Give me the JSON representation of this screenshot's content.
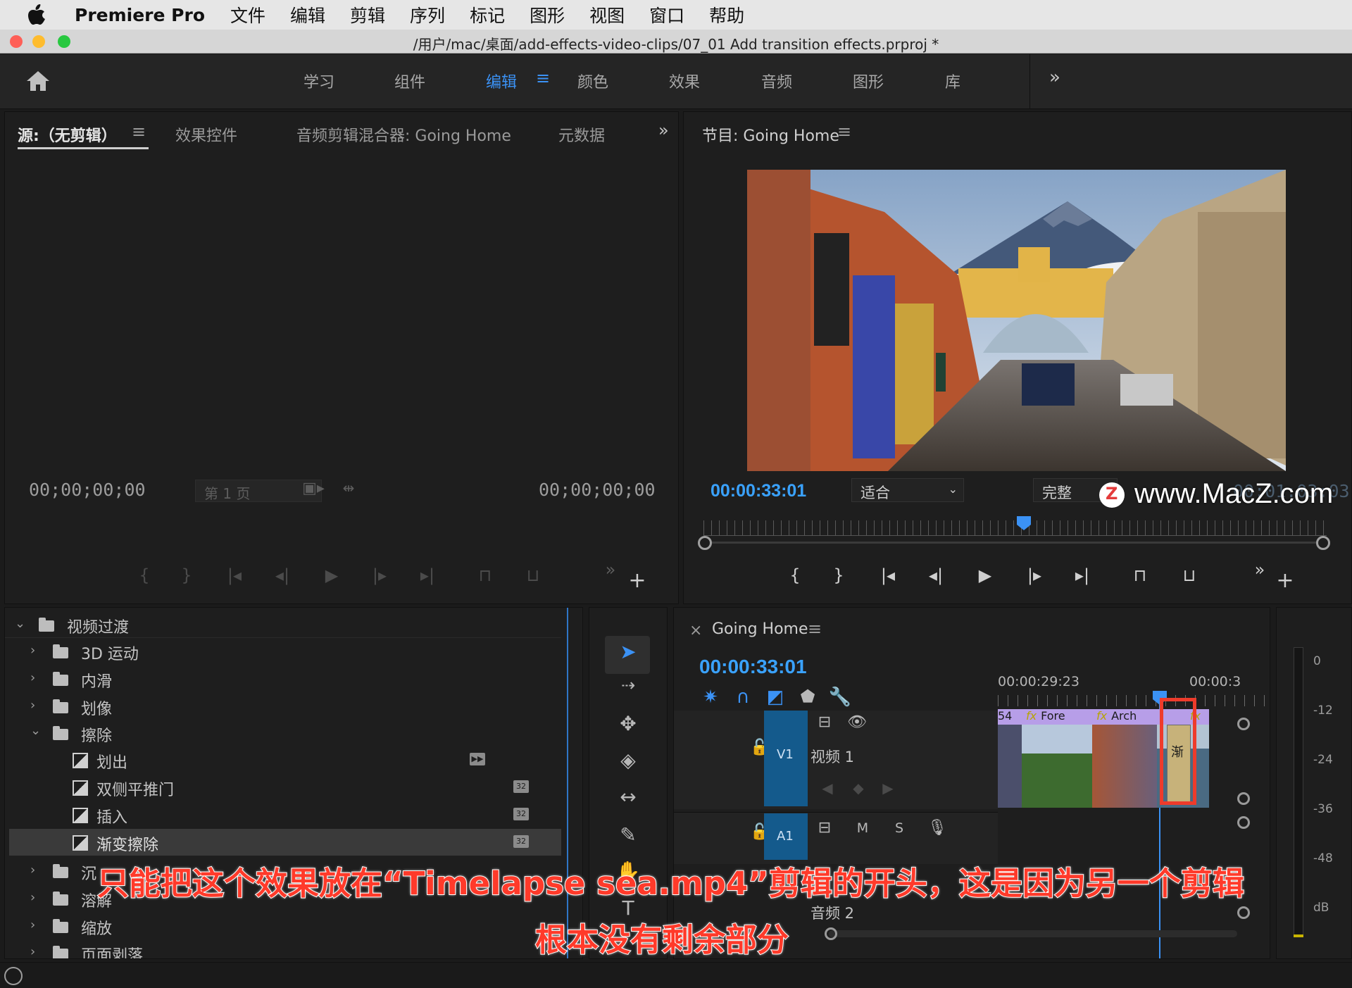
{
  "menubar": {
    "app_name": "Premiere Pro",
    "items": [
      "文件",
      "编辑",
      "剪辑",
      "序列",
      "标记",
      "图形",
      "视图",
      "窗口",
      "帮助"
    ]
  },
  "titlebar": {
    "path": "/用户/mac/桌面/add-effects-video-clips/07_01 Add transition effects.prproj *"
  },
  "workspaces": {
    "tabs": [
      "学习",
      "组件",
      "编辑",
      "颜色",
      "效果",
      "音频",
      "图形",
      "库"
    ],
    "active": "编辑"
  },
  "source_panel": {
    "tabs": [
      "源:（无剪辑）",
      "效果控件",
      "音频剪辑混合器: Going Home",
      "元数据"
    ],
    "timecode_left": "00;00;00;00",
    "timecode_right": "00;00;00;00",
    "page_select": "第 1 页"
  },
  "program_panel": {
    "title": "节目: Going Home",
    "timecode": "00:00:33:01",
    "fit_select": "适合",
    "quality_select": "完整",
    "duration_partial": "00:01:03:03"
  },
  "watermark": {
    "text": "www.MacZ.com",
    "logo_letter": "Z"
  },
  "effects_panel": {
    "root": "视频过渡",
    "folders": [
      {
        "name": "3D 运动",
        "expanded": false
      },
      {
        "name": "内滑",
        "expanded": false
      },
      {
        "name": "划像",
        "expanded": false
      },
      {
        "name": "擦除",
        "expanded": true
      }
    ],
    "wipe_items": [
      "划出",
      "双侧平推门",
      "插入",
      "渐变擦除"
    ],
    "selected_item": "渐变擦除",
    "more_folders": [
      "沉",
      "溶解",
      "缩放",
      "页面剥落"
    ],
    "badge_32": "32"
  },
  "timeline": {
    "title": "Going Home",
    "timecode": "00:00:33:01",
    "ruler_labels": [
      "00:00:29:23",
      "00:00:3"
    ],
    "tracks": {
      "v1_label": "V1",
      "v1_name": "视频 1",
      "a1_label": "A1",
      "a2_name": "音频 2",
      "mute": "M",
      "solo": "S"
    },
    "clips": [
      "54",
      "Fore",
      "Arch",
      "fx"
    ],
    "transition_label": "渐"
  },
  "meter_scale": [
    "0",
    "-12",
    "-24",
    "-36",
    "-48",
    "dB"
  ],
  "caption": {
    "line1": "只能把这个效果放在“Timelapse sea.mp4”剪辑的开头，这是因为另一个剪辑",
    "line2": "根本没有剩余部分"
  },
  "colors": {
    "accent_blue": "#3b92f5",
    "timecode_blue": "#3aa2ff",
    "highlight_red": "#ee3b2b",
    "clip_purple": "#b79ee8",
    "track_blue": "#145a8c"
  }
}
